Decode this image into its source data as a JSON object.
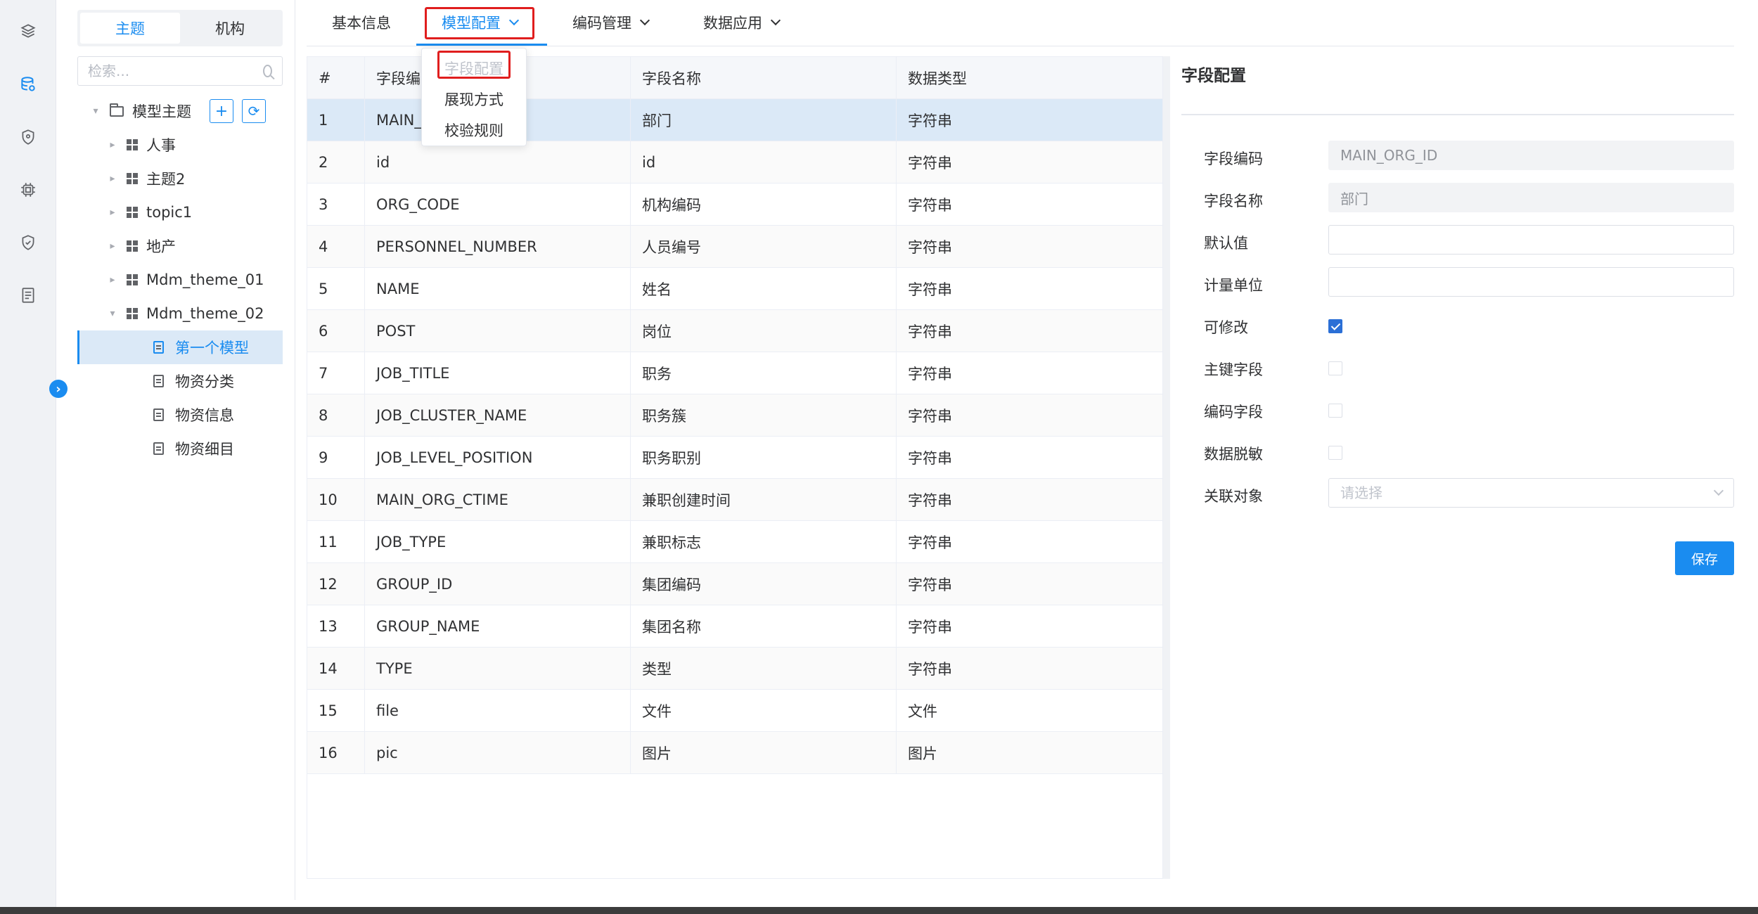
{
  "colors": {
    "accent": "#1a8cf0",
    "highlight": "#e01e1e",
    "selected_row": "#dbe9f7"
  },
  "rail": {
    "icons": [
      "layers-icon",
      "database-icon",
      "shield-icon",
      "chip-icon",
      "security-icon",
      "document-list-icon"
    ],
    "toggle_glyph": "›"
  },
  "tree": {
    "segments": [
      "主题",
      "机构"
    ],
    "active_segment": "主题",
    "search_placeholder": "检索...",
    "root": {
      "label": "模型主题",
      "add_glyph": "+",
      "refresh_glyph": "⟳"
    },
    "items": [
      {
        "label": "人事",
        "type": "topic",
        "expanded": false
      },
      {
        "label": "主题2",
        "type": "topic",
        "expanded": false
      },
      {
        "label": "topic1",
        "type": "topic",
        "expanded": false
      },
      {
        "label": "地产",
        "type": "topic",
        "expanded": false
      },
      {
        "label": "Mdm_theme_01",
        "type": "topic",
        "expanded": false
      },
      {
        "label": "Mdm_theme_02",
        "type": "topic",
        "expanded": true
      },
      {
        "label": "第一个模型",
        "type": "model",
        "selected": true
      },
      {
        "label": "物资分类",
        "type": "model"
      },
      {
        "label": "物资信息",
        "type": "model"
      },
      {
        "label": "物资细目",
        "type": "model"
      }
    ]
  },
  "tabs": [
    {
      "label": "基本信息",
      "has_dropdown": false
    },
    {
      "label": "模型配置",
      "has_dropdown": true,
      "active": true
    },
    {
      "label": "编码管理",
      "has_dropdown": true
    },
    {
      "label": "数据应用",
      "has_dropdown": true
    }
  ],
  "dropdown": {
    "items": [
      {
        "label": "字段配置",
        "disabled": true
      },
      {
        "label": "展现方式"
      },
      {
        "label": "校验规则"
      }
    ]
  },
  "table": {
    "headers": [
      "#",
      "字段编",
      "字段名称",
      "数据类型"
    ],
    "rows": [
      [
        "1",
        "MAIN_(",
        "部门",
        "字符串"
      ],
      [
        "2",
        "id",
        "id",
        "字符串"
      ],
      [
        "3",
        "ORG_CODE",
        "机构编码",
        "字符串"
      ],
      [
        "4",
        "PERSONNEL_NUMBER",
        "人员编号",
        "字符串"
      ],
      [
        "5",
        "NAME",
        "姓名",
        "字符串"
      ],
      [
        "6",
        "POST",
        "岗位",
        "字符串"
      ],
      [
        "7",
        "JOB_TITLE",
        "职务",
        "字符串"
      ],
      [
        "8",
        "JOB_CLUSTER_NAME",
        "职务簇",
        "字符串"
      ],
      [
        "9",
        "JOB_LEVEL_POSITION",
        "职务职别",
        "字符串"
      ],
      [
        "10",
        "MAIN_ORG_CTIME",
        "兼职创建时间",
        "字符串"
      ],
      [
        "11",
        "JOB_TYPE",
        "兼职标志",
        "字符串"
      ],
      [
        "12",
        "GROUP_ID",
        "集团编码",
        "字符串"
      ],
      [
        "13",
        "GROUP_NAME",
        "集团名称",
        "字符串"
      ],
      [
        "14",
        "TYPE",
        "类型",
        "字符串"
      ],
      [
        "15",
        "file",
        "文件",
        "文件"
      ],
      [
        "16",
        "pic",
        "图片",
        "图片"
      ]
    ]
  },
  "form": {
    "title": "字段配置",
    "field_code": {
      "label": "字段编码",
      "value": "MAIN_ORG_ID"
    },
    "field_name": {
      "label": "字段名称",
      "value": "部门"
    },
    "default_value": {
      "label": "默认值",
      "value": ""
    },
    "unit": {
      "label": "计量单位",
      "value": ""
    },
    "editable": {
      "label": "可修改",
      "checked": true
    },
    "primary_key": {
      "label": "主键字段",
      "checked": false
    },
    "code_field": {
      "label": "编码字段",
      "checked": false
    },
    "masking": {
      "label": "数据脱敏",
      "checked": false
    },
    "related": {
      "label": "关联对象",
      "placeholder": "请选择"
    },
    "save_label": "保存"
  }
}
